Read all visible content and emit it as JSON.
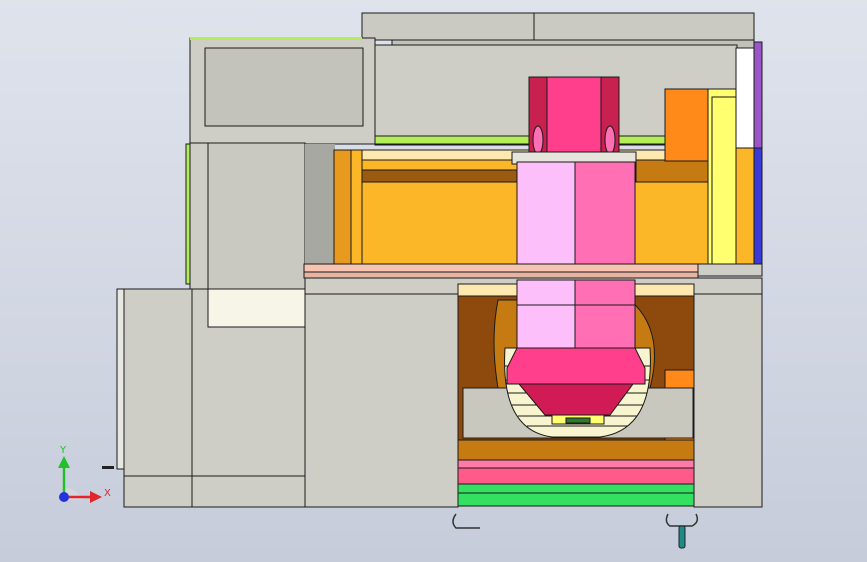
{
  "view": {
    "type": "cad-section-view",
    "background": [
      "#dfe3ec",
      "#c6ccda"
    ]
  },
  "triad": {
    "x_label": "X",
    "y_label": "Y",
    "x_color": "#e0262a",
    "y_color": "#22c02a",
    "z_color": "#2233dd"
  },
  "palette": {
    "frame_gray": "#c9c8bf",
    "spindle_magenta": "#ff3f8c",
    "spindle_dark": "#c8214f",
    "spindle_pink": "#ff6fb4",
    "spindle_light": "#fdbffa",
    "carriage_orange": "#fcb728",
    "carriage_dark": "#c67a12",
    "saddle_brown": "#8e4a0c",
    "rail_green": "#b3ee5a",
    "table_green": "#33e060",
    "table_pink": "#ff5a8a",
    "accent_yellow": "#ffff70",
    "accent_orange": "#ff8a1a",
    "side_purple": "#9a55c8",
    "side_blue": "#3a3ad8",
    "salmon": "#f7c4b2",
    "cream": "#f7f4cf"
  }
}
